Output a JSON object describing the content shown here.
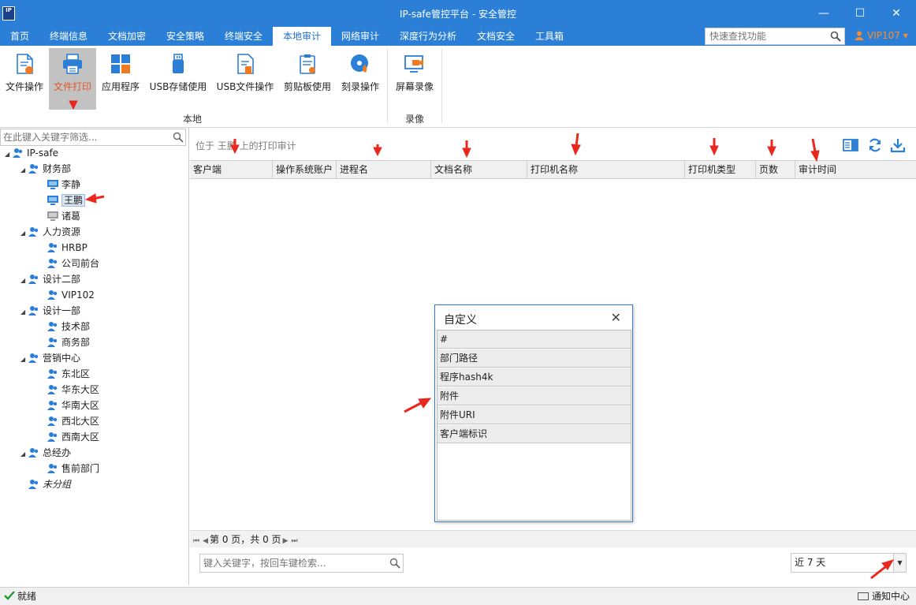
{
  "window": {
    "logo": "IP",
    "title": "IP-safe管控平台 - 安全管控",
    "minimize": "—",
    "maximize": "☐",
    "close": "✕"
  },
  "menu": {
    "items": [
      "首页",
      "终端信息",
      "文档加密",
      "安全策略",
      "终端安全",
      "本地审计",
      "网络审计",
      "深度行为分析",
      "文档安全",
      "工具箱"
    ],
    "active": "本地审计",
    "quick_search_placeholder": "快速查找功能",
    "user": "VIP107",
    "user_caret": "▾"
  },
  "ribbon": {
    "buttons": [
      "文件操作",
      "文件打印",
      "应用程序",
      "USB存储使用",
      "USB文件操作",
      "剪贴板使用",
      "刻录操作",
      "屏幕录像"
    ],
    "active": "文件打印",
    "groups": [
      "本地",
      "录像"
    ]
  },
  "left": {
    "filter_placeholder": "在此键入关键字筛选...",
    "tree": {
      "root": "IP-safe",
      "finance": "财务部",
      "finance_items": [
        "李静",
        "王鹏",
        "诸葛"
      ],
      "hr": "人力资源",
      "hr_items": [
        "HRBP",
        "公司前台"
      ],
      "design2": "设计二部",
      "design2_items": [
        "VIP102"
      ],
      "design1": "设计一部",
      "design1_items": [
        "技术部",
        "商务部"
      ],
      "marketing": "营销中心",
      "marketing_items": [
        "东北区",
        "华东大区",
        "华南大区",
        "西北大区",
        "西南大区"
      ],
      "gm": "总经办",
      "gm_items": [
        "售前部门"
      ],
      "ungrouped": "未分组"
    }
  },
  "main": {
    "location": "位于 王鹏 上的打印审计",
    "columns": [
      "客户端",
      "操作系统账户",
      "进程名",
      "文档名称",
      "打印机名称",
      "打印机类型",
      "页数",
      "审计时间"
    ],
    "pager": {
      "text": "第 0 页，共 0 页"
    },
    "search_placeholder": "键入关键字，按回车键检索...",
    "range": "近 7 天"
  },
  "dialog": {
    "title": "自定义",
    "items": [
      "#",
      "部门路径",
      "程序hash4k",
      "附件",
      "附件URI",
      "客户端标识"
    ]
  },
  "status": {
    "ready": "就绪",
    "notify": "通知中心"
  },
  "colors": {
    "accent": "#2b7fd6",
    "highlight": "#e2572b",
    "user": "#ff8a2a",
    "annotation": "#e8281e"
  }
}
